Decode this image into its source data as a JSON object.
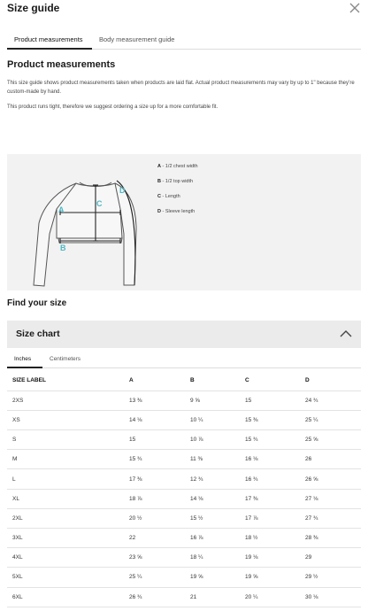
{
  "header": {
    "title": "Size guide",
    "close_icon": "close-icon"
  },
  "tabs": [
    {
      "label": "Product measurements",
      "active": true
    },
    {
      "label": "Body measurement guide",
      "active": false
    }
  ],
  "product": {
    "title": "Product measurements",
    "para1": "This size guide shows product measurements taken when products are laid flat. Actual product measurements may vary by up to 1\" because they’re custom-made by hand.",
    "para2": "This product runs tight, therefore we suggest ordering a size up for a more comfortable fit."
  },
  "diagram": {
    "markers": {
      "a": "A",
      "b": "B",
      "c": "C",
      "d": "D"
    },
    "legend": [
      {
        "letter": "A",
        "text": " - 1/2 chest width"
      },
      {
        "letter": "B",
        "text": " - 1/2 top width"
      },
      {
        "letter": "C",
        "text": " - Length"
      },
      {
        "letter": "D",
        "text": " - Sleeve length"
      }
    ],
    "accent_color": "#4cb8c4"
  },
  "find_size": "Find your size",
  "size_chart": {
    "title": "Size chart",
    "expanded": true,
    "chevron_icon": "chevron-up-icon"
  },
  "units": [
    {
      "label": "Inches",
      "active": true
    },
    {
      "label": "Centimeters",
      "active": false
    }
  ],
  "table": {
    "headers": [
      "SIZE LABEL",
      "A",
      "B",
      "C",
      "D"
    ],
    "rows": [
      [
        "2XS",
        "13 ⅜",
        "9 ⅝",
        "15",
        "24 ¾"
      ],
      [
        "XS",
        "14 ⅛",
        "10 ¼",
        "15 ⅜",
        "25 ¼"
      ],
      [
        "S",
        "15",
        "10 ⅞",
        "15 ¾",
        "25 ⅝"
      ],
      [
        "M",
        "15 ¾",
        "11 ⅜",
        "16 ⅛",
        "26"
      ],
      [
        "L",
        "17 ⅜",
        "12 ¾",
        "16 ¾",
        "26 ⅝"
      ],
      [
        "XL",
        "18 ⅞",
        "14 ⅛",
        "17 ⅜",
        "27 ⅛"
      ],
      [
        "2XL",
        "20 ½",
        "15 ½",
        "17 ⅞",
        "27 ¾"
      ],
      [
        "3XL",
        "22",
        "16 ⅞",
        "18 ½",
        "28 ⅜"
      ],
      [
        "4XL",
        "23 ⅝",
        "18 ¼",
        "19 ⅛",
        "29"
      ],
      [
        "5XL",
        "25 ¼",
        "19 ⅝",
        "19 ⅝",
        "29 ½"
      ],
      [
        "6XL",
        "26 ¾",
        "21",
        "20 ¼",
        "30 ⅛"
      ]
    ]
  }
}
